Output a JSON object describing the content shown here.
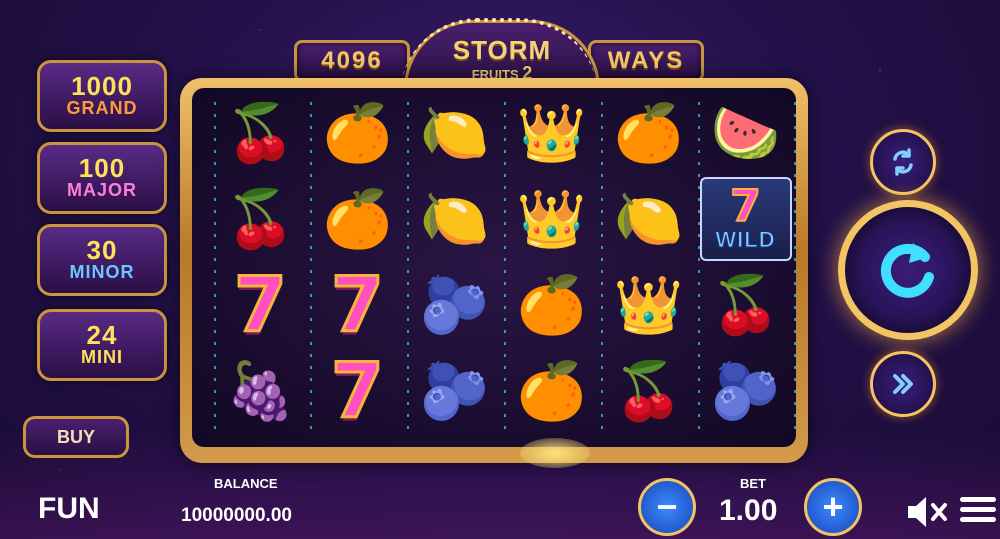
{
  "banner": {
    "left": "4096",
    "right": "WAYS",
    "logo_line1": "STORM",
    "logo_line2": "FRUITS",
    "logo_num": "2"
  },
  "jackpots": [
    {
      "amount": "1000",
      "label": "GRAND",
      "amount_color": "#ffe15a",
      "label_color": "#ff9c3a"
    },
    {
      "amount": "100",
      "label": "MAJOR",
      "amount_color": "#ffe15a",
      "label_color": "#ff7fd6"
    },
    {
      "amount": "30",
      "label": "MINOR",
      "amount_color": "#ffe15a",
      "label_color": "#6ac6ff"
    },
    {
      "amount": "24",
      "label": "MINI",
      "amount_color": "#ffe15a",
      "label_color": "#ffe15a"
    }
  ],
  "buy_label": "BUY",
  "reels": [
    [
      "cherry",
      "orange",
      "lemon",
      "crown",
      "orange",
      "watermelon"
    ],
    [
      "cherry",
      "orange",
      "lemon",
      "crown",
      "lemon",
      "wild"
    ],
    [
      "seven",
      "seven",
      "plum",
      "orange",
      "crown",
      "cherry"
    ],
    [
      "grape",
      "seven",
      "plum",
      "orange",
      "cherry",
      "plum"
    ]
  ],
  "wild": {
    "seven": "7",
    "label": "WILD"
  },
  "symbols": {
    "cherry": "🍒",
    "orange": "🍊",
    "lemon": "🍋",
    "crown": "👑",
    "watermelon": "🍉",
    "plum": "🫐",
    "grape": "🍇",
    "seven": "7"
  },
  "footer": {
    "mode": "FUN",
    "balance_label": "BALANCE",
    "balance_value": "10000000.00",
    "bet_label": "BET",
    "bet_value": "1.00",
    "minus_symbol": "−",
    "plus_symbol": "+"
  },
  "icons": {
    "autoplay": "autoplay-icon",
    "spin": "spin-icon",
    "turbo": "turbo-icon",
    "mute": "speaker-muted-icon",
    "menu": "menu-icon"
  }
}
